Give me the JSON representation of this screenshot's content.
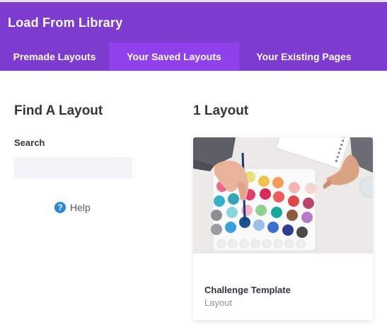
{
  "header": {
    "title": "Load From Library"
  },
  "tabs": [
    {
      "label": "Premade Layouts",
      "active": false
    },
    {
      "label": "Your Saved Layouts",
      "active": true
    },
    {
      "label": "Your Existing Pages",
      "active": false
    }
  ],
  "sidebar": {
    "title": "Find A Layout",
    "search_label": "Search",
    "search_value": "",
    "help_label": "Help",
    "help_icon": "question-circle-icon"
  },
  "results": {
    "title": "1 Layout",
    "layouts": [
      {
        "name": "Challenge Template",
        "type": "Layout",
        "thumbnail": "watercolor-palette-photo"
      }
    ]
  },
  "colors": {
    "header": "#7e3bd0",
    "active_tab": "#8f42ec",
    "help_icon": "#2b87da"
  }
}
